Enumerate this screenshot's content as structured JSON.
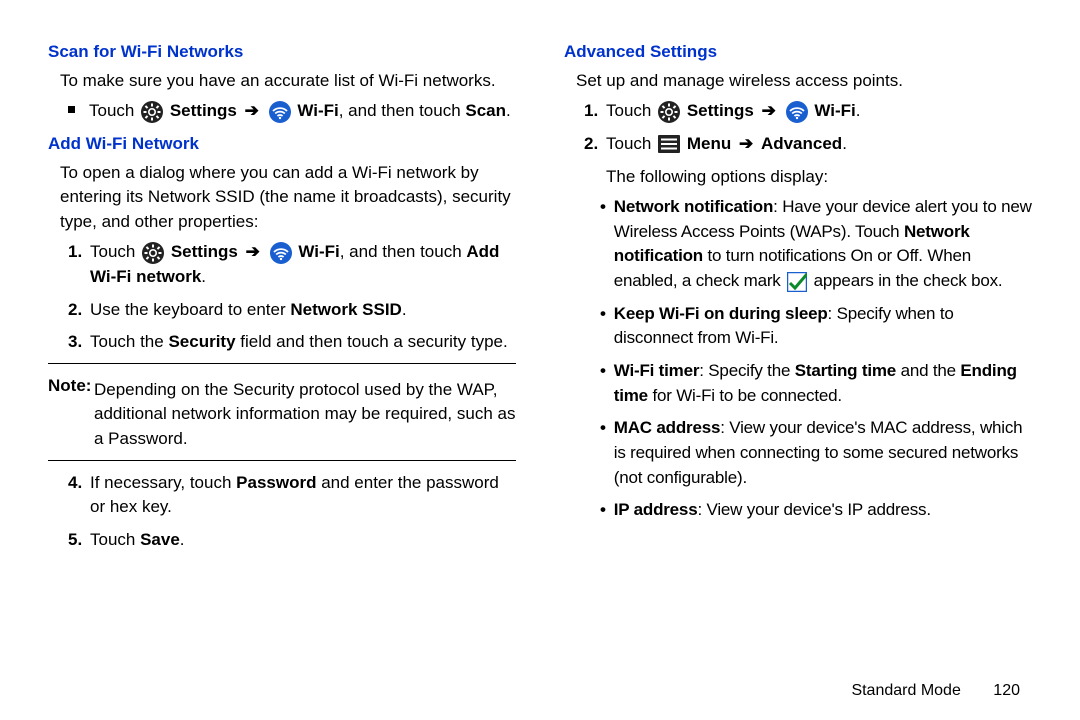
{
  "left": {
    "h1": "Scan for Wi-Fi Networks",
    "p1": "To make sure you have an accurate list of Wi-Fi networks.",
    "bullet1_a": "Touch ",
    "bullet1_settings": "Settings",
    "bullet1_wifi": "Wi-Fi",
    "bullet1_b": ", and then touch ",
    "bullet1_scan": "Scan",
    "h2": "Add Wi-Fi Network",
    "p2": "To open a dialog where you can add a Wi-Fi network by entering its Network SSID (the name it broadcasts), security type, and other properties:",
    "step1_a": "Touch ",
    "step1_settings": "Settings",
    "step1_wifi": "Wi-Fi",
    "step1_b": ", and then touch ",
    "step1_add": "Add Wi-Fi network",
    "step2_a": "Use the keyboard to enter ",
    "step2_b": "Network SSID",
    "step3_a": "Touch the ",
    "step3_b": "Security",
    "step3_c": " field and then touch a security type.",
    "note_label": "Note:",
    "note_body": "Depending on the Security protocol used by the WAP, additional network information may be required, such as a Password.",
    "step4_a": "If necessary, touch ",
    "step4_b": "Password",
    "step4_c": " and enter the password or hex key.",
    "step5_a": "Touch ",
    "step5_b": "Save"
  },
  "right": {
    "h1": "Advanced Settings",
    "p1": "Set up and manage wireless access points.",
    "step1_a": "Touch ",
    "step1_settings": "Settings",
    "step1_wifi": "Wi-Fi",
    "step2_a": "Touch ",
    "step2_menu": "Menu",
    "step2_adv": "Advanced",
    "p2": "The following options display:",
    "b1_a": "Network notification",
    "b1_b": ": Have your device alert you to new Wireless Access Points (WAPs). Touch ",
    "b1_c": "Network notification",
    "b1_d": " to turn notifications On or Off. When enabled, a check mark ",
    "b1_e": " appears in the check box.",
    "b2_a": "Keep Wi-Fi on during sleep",
    "b2_b": ": Specify when to disconnect from Wi-Fi.",
    "b3_a": "Wi-Fi timer",
    "b3_b": ": Specify the ",
    "b3_c": "Starting time",
    "b3_d": " and the ",
    "b3_e": "Ending time",
    "b3_f": " for Wi-Fi to be connected.",
    "b4_a": "MAC address",
    "b4_b": ": View your device's MAC address, which is required when connecting to some secured networks (not configurable).",
    "b5_a": "IP address",
    "b5_b": ": View your device's IP address."
  },
  "footer": {
    "mode": "Standard Mode",
    "page": "120"
  },
  "nums": {
    "n1": "1.",
    "n2": "2.",
    "n3": "3.",
    "n4": "4.",
    "n5": "5."
  },
  "period": "."
}
